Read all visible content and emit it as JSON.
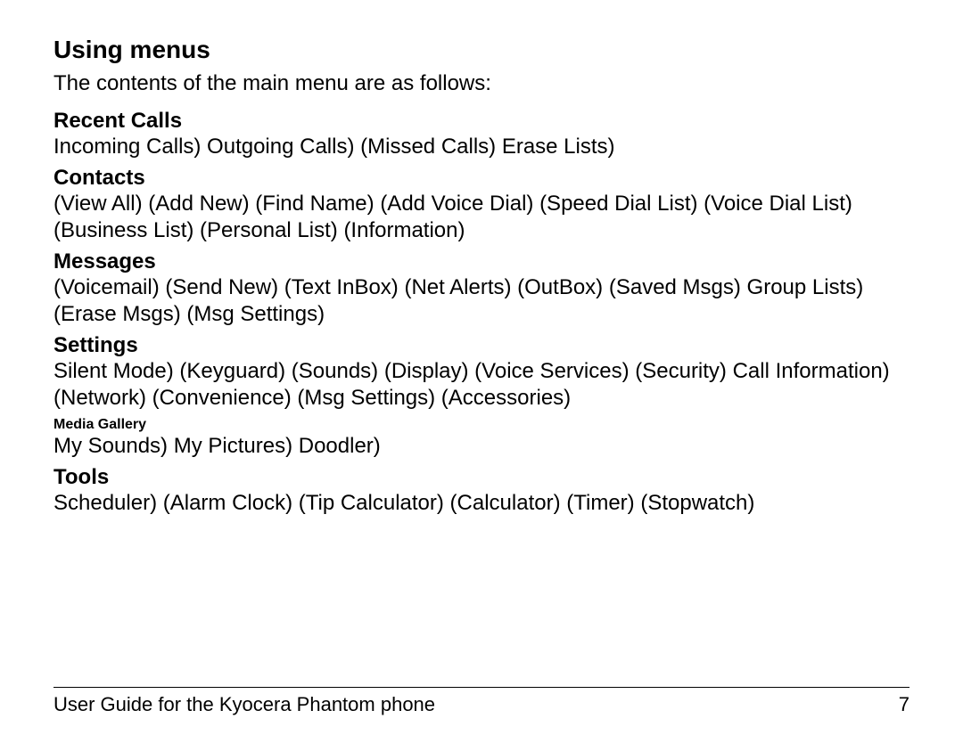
{
  "heading": "Using menus",
  "intro": "The contents of the main menu are as follows:",
  "sections": {
    "recent_calls": {
      "title": "Recent Calls",
      "body": "Incoming Calls) Outgoing Calls) (Missed Calls) Erase Lists)"
    },
    "contacts": {
      "title": "Contacts",
      "body": "(View All) (Add New) (Find Name) (Add Voice Dial) (Speed Dial List) (Voice Dial List) (Business List) (Personal List) (Information)"
    },
    "messages": {
      "title": "Messages",
      "body": "(Voicemail) (Send New) (Text InBox) (Net Alerts) (OutBox) (Saved Msgs) Group Lists) (Erase Msgs) (Msg Settings)"
    },
    "settings": {
      "title": "Settings",
      "body": "Silent Mode) (Keyguard) (Sounds) (Display) (Voice Services) (Security) Call Information) (Network) (Convenience) (Msg Settings) (Accessories)"
    },
    "media_gallery": {
      "title": "Media Gallery",
      "body": "My Sounds) My Pictures) Doodler)"
    },
    "tools": {
      "title": "Tools",
      "body": "Scheduler) (Alarm Clock) (Tip Calculator) (Calculator) (Timer) (Stopwatch)"
    }
  },
  "footer": {
    "text": "User Guide for the Kyocera Phantom phone",
    "page": "7"
  }
}
